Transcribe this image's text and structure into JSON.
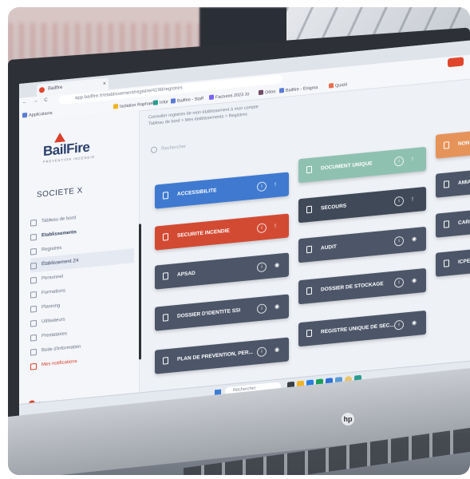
{
  "browser": {
    "tab_title": "Bailfire",
    "tab_close": "×",
    "nav_buttons": "← → C",
    "url": "app.bailfire.fr/etablissement/registre/4198/registres",
    "bookmarks": [
      "Applications",
      "Isolation Raphael",
      "Infor",
      "Bailfire - Staff",
      "Factures 2023 Jo",
      "Odoo",
      "Bailfire - Enigma",
      "Quickl"
    ]
  },
  "sidebar": {
    "logo_text": "BailFire",
    "logo_subtitle": "PREVENTION INCENDIE",
    "company": "SOCIETE X",
    "nav_items": [
      {
        "label": "Tableau de bord",
        "style": "normal"
      },
      {
        "label": "Etablissements",
        "style": "bold"
      },
      {
        "label": "Registres",
        "style": "normal"
      },
      {
        "label": "Établissement Z4",
        "style": "active"
      },
      {
        "label": "Personnel",
        "style": "normal"
      },
      {
        "label": "Formations",
        "style": "normal"
      },
      {
        "label": "Planning",
        "style": "normal"
      },
      {
        "label": "Utilisateurs",
        "style": "normal"
      },
      {
        "label": "Prestataires",
        "style": "normal"
      },
      {
        "label": "Boite d'information",
        "style": "normal"
      },
      {
        "label": "Mes notifications",
        "style": "alert"
      }
    ],
    "footer": "Déconnexion"
  },
  "main": {
    "breadcrumb_1": "Consulter registres de mon établissement à mon compte",
    "breadcrumb_2": "Tableau de bord > Mes établissements > Registres",
    "search_placeholder": "Rechercher"
  },
  "cards": [
    {
      "label": "ACCESSIBILITE",
      "color": "#3f7ad0",
      "info": "i",
      "right": "!"
    },
    {
      "label": "SECURITE INCENDIE",
      "color": "#d34a33",
      "info": "i",
      "right": "!"
    },
    {
      "label": "APSAD",
      "color": "#4c5668",
      "info": "i",
      "right": "◉"
    },
    {
      "label": "DOSSIER D'IDENTITE SSI",
      "color": "#4c5668",
      "info": "i",
      "right": "◉"
    },
    {
      "label": "PLAN DE PREVENTION, PER...",
      "color": "#4c5668",
      "info": "i",
      "right": "◉"
    },
    {
      "label": "DOCUMENT UNIQUE",
      "color": "#8fc1b1",
      "info": "i",
      "right": "!"
    },
    {
      "label": "SECOURS",
      "color": "#3f4958",
      "info": "i",
      "right": "!"
    },
    {
      "label": "AUDIT",
      "color": "#4c5668",
      "info": "i",
      "right": "◉"
    },
    {
      "label": "DOSSIER DE STOCKAGE",
      "color": "#4c5668",
      "info": "i",
      "right": "◉"
    },
    {
      "label": "REGISTRE UNIQUE DE SEC...",
      "color": "#4c5668",
      "info": "i",
      "right": "◉"
    },
    {
      "label": "NON CONFORMITE",
      "color": "#e6935a",
      "info": "",
      "right": ""
    },
    {
      "label": "AMIANTE",
      "color": "#4c5668",
      "info": "",
      "right": ""
    },
    {
      "label": "CARNET",
      "color": "#4c5668",
      "info": "",
      "right": ""
    },
    {
      "label": "ICPE",
      "color": "#4c5668",
      "info": "",
      "right": ""
    }
  ],
  "taskbar": {
    "search_label": "Rechercher"
  },
  "device": {
    "brand_badge": "hp"
  }
}
